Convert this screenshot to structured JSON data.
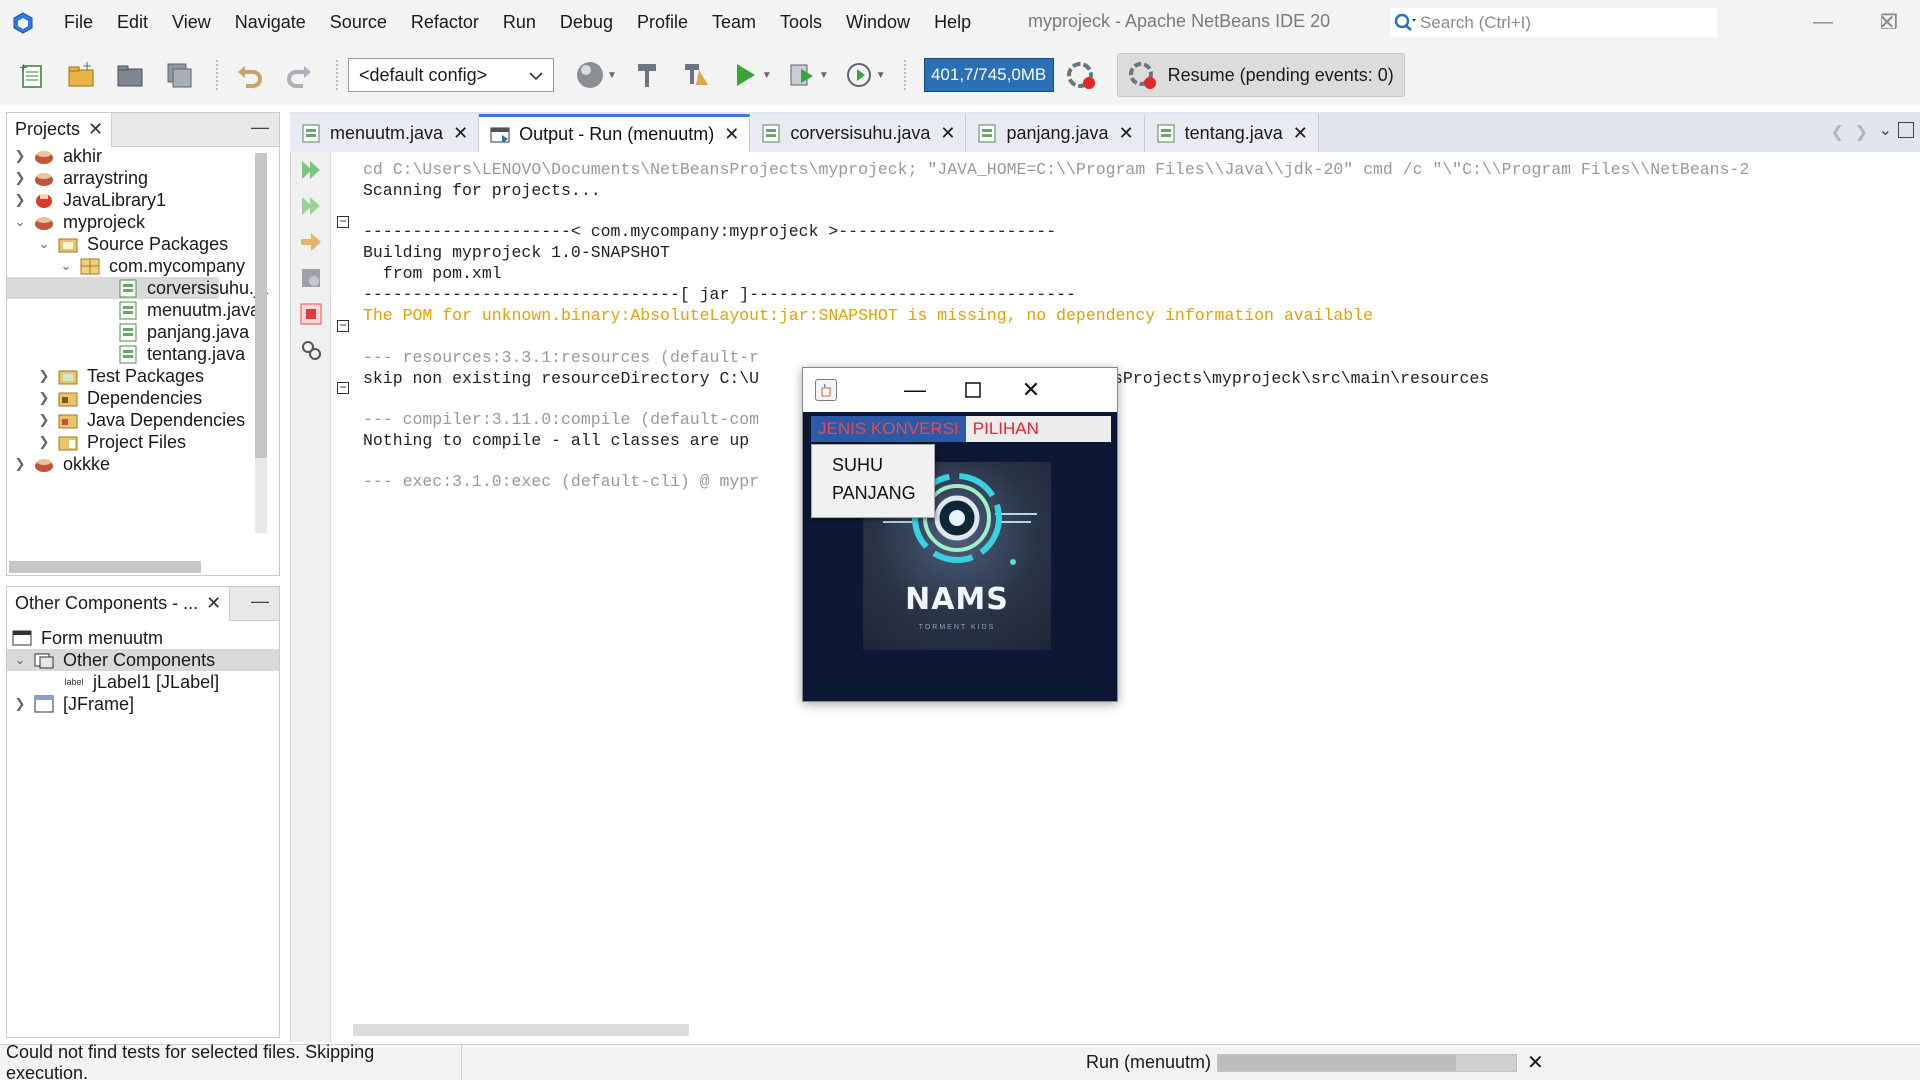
{
  "window": {
    "title": "myprojeck - Apache NetBeans IDE 20",
    "search_placeholder": "Search (Ctrl+I)"
  },
  "menu": {
    "items": [
      "File",
      "Edit",
      "View",
      "Navigate",
      "Source",
      "Refactor",
      "Run",
      "Debug",
      "Profile",
      "Team",
      "Tools",
      "Window",
      "Help"
    ]
  },
  "toolbar": {
    "config_value": "<default config>",
    "memory": "401,7/745,0MB",
    "resume_label": "Resume (pending events: 0)"
  },
  "projects_panel": {
    "tab_label": "Projects",
    "rows": [
      {
        "label": "akhir",
        "icon": "maven-project-icon"
      },
      {
        "label": "arraystring",
        "icon": "maven-project-icon"
      },
      {
        "label": "JavaLibrary1",
        "icon": "java-library-icon"
      },
      {
        "label": "myprojeck",
        "icon": "maven-project-icon"
      },
      {
        "label": "Source Packages",
        "icon": "source-packages-icon"
      },
      {
        "label": "com.mycompany",
        "icon": "package-icon"
      },
      {
        "label": "corversisuhu.ja",
        "icon": "java-form-icon"
      },
      {
        "label": "menuutm.java",
        "icon": "java-form-icon"
      },
      {
        "label": "panjang.java",
        "icon": "java-form-icon"
      },
      {
        "label": "tentang.java",
        "icon": "java-form-icon"
      },
      {
        "label": "Test Packages",
        "icon": "test-packages-icon"
      },
      {
        "label": "Dependencies",
        "icon": "dependencies-icon"
      },
      {
        "label": "Java Dependencies",
        "icon": "java-dependencies-icon"
      },
      {
        "label": "Project Files",
        "icon": "project-files-icon"
      },
      {
        "label": "okkke",
        "icon": "maven-project-icon"
      }
    ]
  },
  "components_panel": {
    "tab_label": "Other Components - ...",
    "rows": [
      {
        "label": "Form menuutm",
        "icon": "form-icon"
      },
      {
        "label": "Other Components",
        "icon": "components-icon"
      },
      {
        "label": "jLabel1 [JLabel]",
        "icon": "label-icon",
        "badge": "label"
      },
      {
        "label": "[JFrame]",
        "icon": "jframe-icon"
      }
    ]
  },
  "editor_tabs": [
    {
      "label": "menuutm.java"
    },
    {
      "label": "Output - Run (menuutm)"
    },
    {
      "label": "corversisuhu.java"
    },
    {
      "label": "panjang.java"
    },
    {
      "label": "tentang.java"
    }
  ],
  "output_lines": [
    "cd C:\\Users\\LENOVO\\Documents\\NetBeansProjects\\myprojeck; \"JAVA_HOME=C:\\\\Program Files\\\\Java\\\\jdk-20\" cmd /c \"\\\"C:\\\\Program Files\\\\NetBeans-2",
    "Scanning for projects...",
    "",
    "---------------------< com.mycompany:myprojeck >----------------------",
    "Building myprojeck 1.0-SNAPSHOT",
    "  from pom.xml",
    "--------------------------------[ jar ]---------------------------------",
    "The POM for unknown.binary:AbsoluteLayout:jar:SNAPSHOT is missing, no dependency information available",
    "",
    "--- resources:3.3.1:resources (default-r",
    "skip non existing resourceDirectory C:\\U",
    "",
    "--- compiler:3.11.0:compile (default-com",
    "Nothing to compile - all classes are up",
    "",
    "--- exec:3.1.0:exec (default-cli) @ mypr"
  ],
  "output_tail": "sProjects\\myprojeck\\src\\main\\resources",
  "app_window": {
    "menu": [
      "JENIS KONVERSI",
      "PILIHAN"
    ],
    "popup_items": [
      "SUHU",
      "PANJANG"
    ],
    "brand_name": "NAMS",
    "brand_tagline": "TORMENT KIDS"
  },
  "statusbar": {
    "message": "Could not find tests for selected files. Skipping execution.",
    "run_label": "Run (menuutm)",
    "progress": 0.8
  },
  "colors": {
    "memory_bg": "#2b6fb7",
    "warning_text": "#e5a100",
    "app_menu_red": "#e8242c",
    "active_tab_accent": "#3d7bd6"
  }
}
